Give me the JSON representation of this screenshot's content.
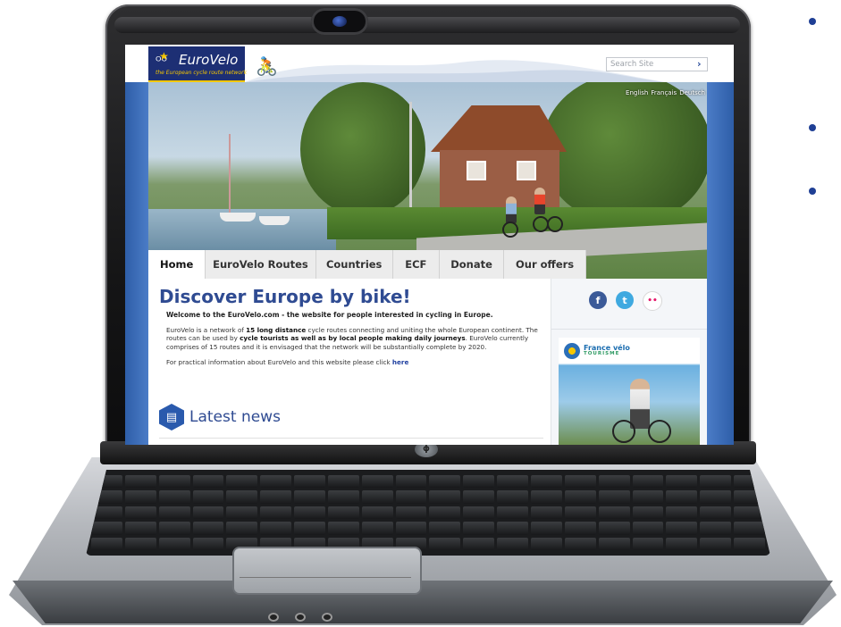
{
  "site": {
    "logo_text": "EuroVelo",
    "logo_tagline": "the European cycle route network",
    "search_placeholder": "Search Site",
    "search_arrow": "›",
    "languages": [
      "English",
      "Français",
      "Deutsch"
    ]
  },
  "nav": {
    "tabs": [
      {
        "label": "Home",
        "active": true
      },
      {
        "label": "EuroVelo Routes",
        "active": false
      },
      {
        "label": "Countries",
        "active": false
      },
      {
        "label": "ECF",
        "active": false
      },
      {
        "label": "Donate",
        "active": false
      },
      {
        "label": "Our offers",
        "active": false
      }
    ]
  },
  "main": {
    "title": "Discover Europe by bike!",
    "welcome": "Welcome to the EuroVelo.com - the website for people interested in cycling in Europe.",
    "para1_a": "EuroVelo is a network of ",
    "para1_b": "15 long distance",
    "para1_c": " cycle routes connecting and uniting the whole European continent.  The routes can be used by ",
    "para1_d": "cycle tourists as well as by local people making daily journeys",
    "para1_e": ". EuroVelo currently comprises of 15 routes and it is envisaged that the network will be substantially complete by 2020.",
    "para2_a": "For practical information about EuroVelo and this website please click ",
    "para2_link": "here",
    "news_title": "Latest news"
  },
  "aside": {
    "social": {
      "facebook": "f",
      "twitter": "t",
      "flickr": "••"
    },
    "ad_brand": "France vélo",
    "ad_brand_sub": "TOURISME"
  },
  "colors": {
    "brand_navy": "#1d2f74",
    "brand_yellow": "#f6c700",
    "accent_blue": "#2f4b92",
    "bullet": "#1f3f95"
  }
}
